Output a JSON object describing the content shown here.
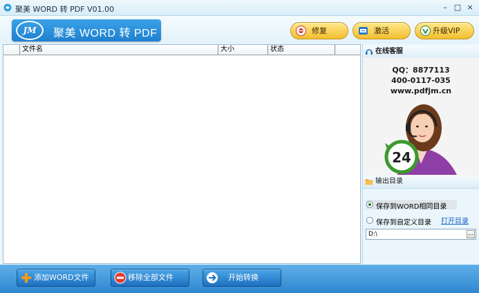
{
  "window": {
    "title": "聚美 WORD 转 PDF V01.00",
    "minimize_glyph": "–",
    "maximize_glyph": "□",
    "close_glyph": "×"
  },
  "header": {
    "logo_mark": "JM",
    "logo_text": "聚美 WORD 转 PDF",
    "repair_label": "修复",
    "activate_label": "激活",
    "upgrade_label": "升级VIP"
  },
  "file_list": {
    "columns": [
      "文件名",
      "大小",
      "状态"
    ],
    "rows": []
  },
  "support": {
    "title": "在线客服",
    "qq": "QQ：8877113",
    "phone": "400-0117-035",
    "website": "www.pdfjm.cn",
    "badge_number": "24"
  },
  "output": {
    "title": "输出目录",
    "option_same_dir": "保存到WORD相同目录",
    "option_custom_dir": "保存到自定义目录",
    "open_dir_link": "打开目录",
    "path_value": "D:\\",
    "browse_label": "..."
  },
  "bottom": {
    "add_label": "添加WORD文件",
    "remove_label": "移除全部文件",
    "start_label": "开始转换"
  },
  "colors": {
    "accent_blue": "#2f86cf",
    "button_gold": "#f2be2e",
    "link_blue": "#1a64c8"
  }
}
